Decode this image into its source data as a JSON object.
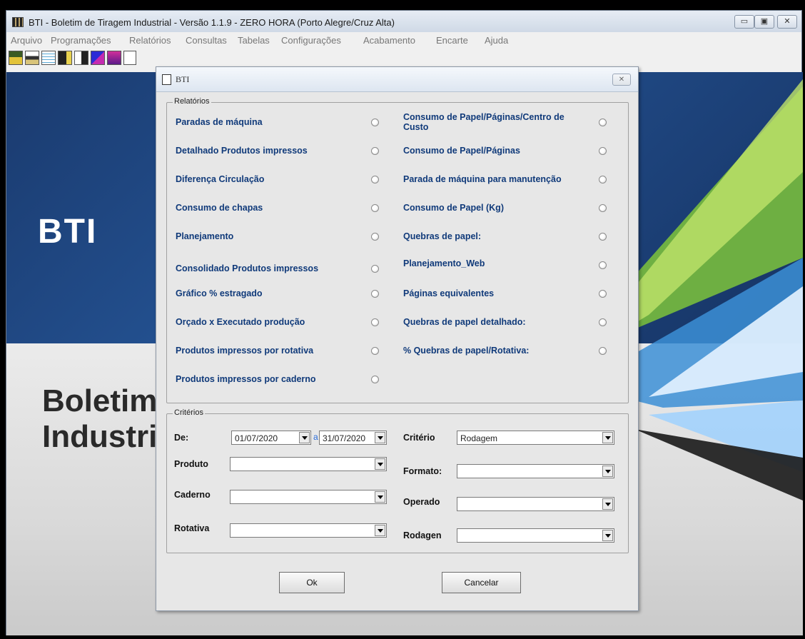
{
  "window": {
    "title": "BTI - Boletim de Tiragem Industrial - Versão 1.1.9 -  ZERO HORA (Porto Alegre/Cruz Alta)",
    "minimize": "▭",
    "maximize": "▣",
    "close": "✕"
  },
  "menu": [
    "Arquivo",
    "Programações",
    "Relatórios",
    "Consultas",
    "Tabelas",
    "Configurações",
    "Acabamento",
    "Encarte",
    "Ajuda"
  ],
  "background": {
    "logo": "BTI",
    "line1": "Boletim",
    "line2": "Industri"
  },
  "dialog": {
    "title": "BTI",
    "close": "✕",
    "reports_group": "Relatórios",
    "reports_left": [
      "Paradas de máquina",
      "Detalhado Produtos impressos",
      "Diferença Circulação",
      "Consumo de chapas",
      "Planejamento",
      "Consolidado Produtos impressos",
      "Gráfico % estragado",
      "Orçado x Executado produção",
      "Produtos impressos por rotativa",
      "Produtos impressos por caderno"
    ],
    "reports_right": [
      "Consumo de Papel/Páginas/Centro de Custo",
      "Consumo de Papel/Páginas",
      "Parada de máquina para manutenção",
      "Consumo de Papel (Kg)",
      "Quebras de papel:",
      "Planejamento_Web",
      "Páginas equivalentes",
      "Quebras de papel detalhado:",
      "% Quebras de papel/Rotativa:"
    ],
    "criteria_group": "Critérios",
    "criteria": {
      "de_label": "De:",
      "date_from": "01/07/2020",
      "date_sep": "a",
      "date_to": "31/07/2020",
      "criterio_label": "Critério",
      "criterio_value": "Rodagem",
      "produto_label": "Produto",
      "produto_value": "",
      "formato_label": "Formato:",
      "formato_value": "",
      "caderno_label": "Caderno",
      "caderno_value": "",
      "operado_label": "Operado",
      "operado_value": "",
      "rotativa_label": "Rotativa",
      "rotativa_value": "",
      "rodagem_label": "Rodagen",
      "rodagem_value": ""
    },
    "ok": "Ok",
    "cancel": "Cancelar"
  },
  "colors": {
    "report_label": "#103a7a",
    "link_accent": "#2a6cd9",
    "bg_blue": "#23508f"
  }
}
